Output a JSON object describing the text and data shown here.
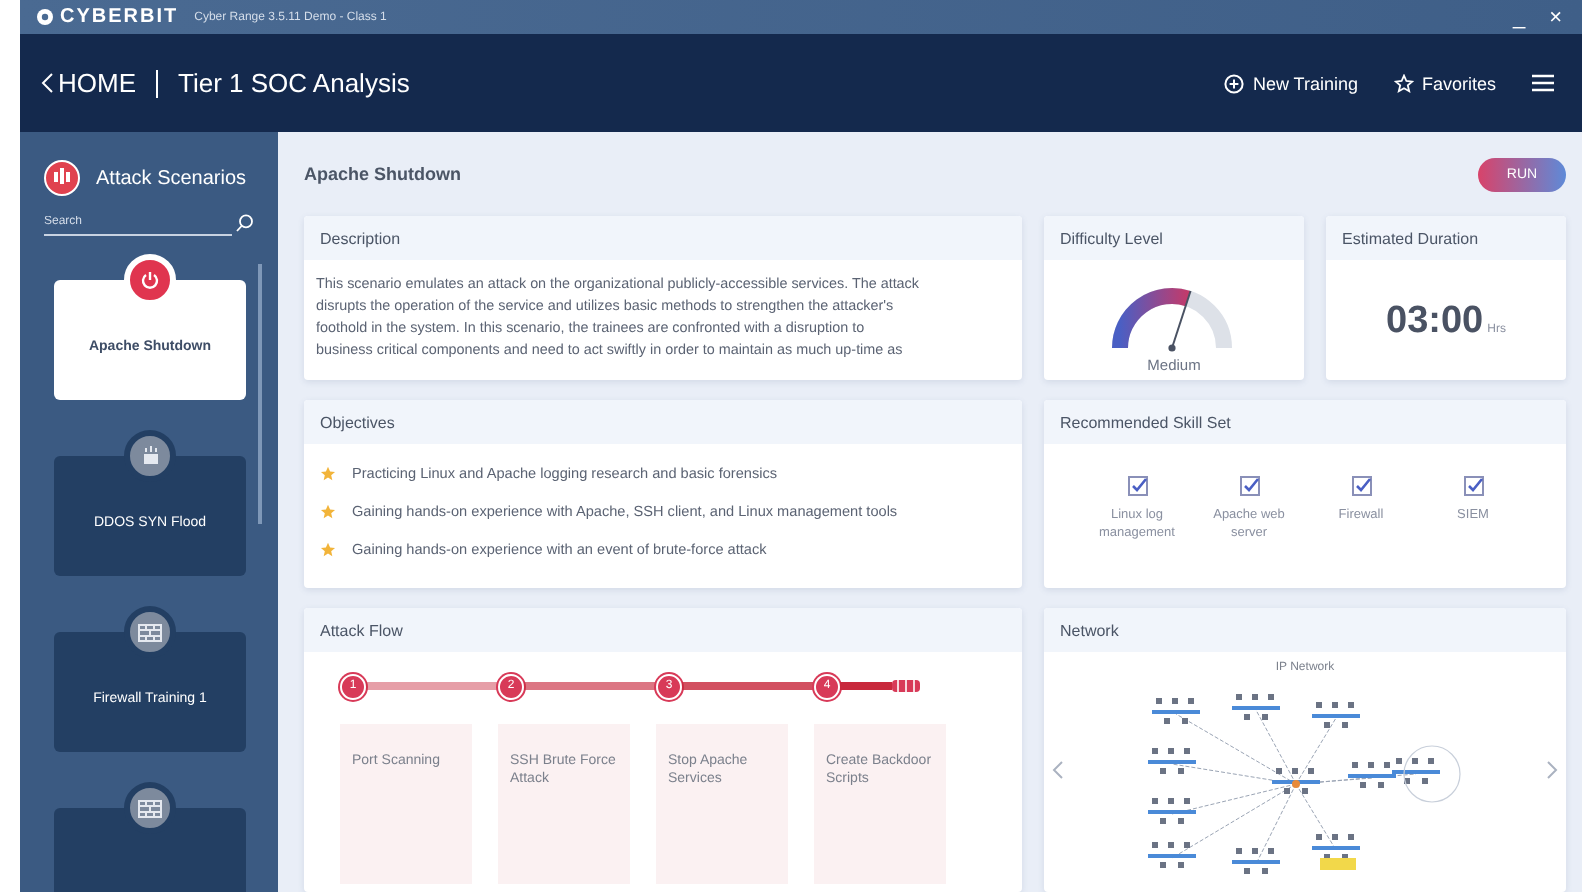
{
  "window": {
    "brand": "CYBERBIT",
    "title": "Cyber Range 3.5.11 Demo - Class 1",
    "controls": [
      "_",
      "×"
    ]
  },
  "nav": {
    "back": "HOME",
    "title": "Tier 1 SOC Analysis",
    "actions": [
      {
        "kind": "new",
        "label": "New Training"
      },
      {
        "kind": "favorites",
        "label": "Favorites"
      }
    ]
  },
  "sidebar": {
    "title": "Attack Scenarios",
    "search": {
      "placeholder": "Search"
    },
    "items": [
      {
        "kind": "power",
        "label": "Apache Shutdown",
        "selected": true
      },
      {
        "kind": "ddos",
        "label": "DDOS SYN Flood",
        "selected": false
      },
      {
        "kind": "firewall",
        "label": "Firewall Training 1",
        "selected": false
      },
      {
        "kind": "firewall",
        "selected": false
      }
    ]
  },
  "scenario": {
    "title": "Apache Shutdown",
    "run": "RUN"
  },
  "description": {
    "title": "Description",
    "lines": [
      "This scenario emulates an attack on the organizational publicly-accessible services. The attack",
      "disrupts the operation of the service and utilizes basic methods to strengthen the attacker's",
      "foothold in the system. In this scenario, the trainees are confronted with a disruption to",
      "business critical components and need to act swiftly in order to maintain as much up-time as"
    ]
  },
  "difficulty": {
    "title": "Difficulty Level",
    "level": 0.6,
    "label": "Medium"
  },
  "duration": {
    "title": "Estimated Duration",
    "value": "03:00",
    "unit": "Hrs"
  },
  "objectives": {
    "title": "Objectives",
    "items": [
      "Practicing Linux and Apache logging research and basic forensics",
      "Gaining hands-on experience with Apache, SSH client, and Linux management tools",
      "Gaining hands-on experience with an event of brute-force attack"
    ]
  },
  "skills": {
    "title": "Recommended Skill Set",
    "items": [
      {
        "label": "Linux log management",
        "checked": true
      },
      {
        "label": "Apache web server",
        "checked": true
      },
      {
        "label": "Firewall",
        "checked": true
      },
      {
        "label": "SIEM",
        "checked": true
      }
    ]
  },
  "attack_flow": {
    "title": "Attack Flow",
    "steps": [
      {
        "number": "1",
        "label": "Port Scanning"
      },
      {
        "number": "2",
        "label": "SSH Brute Force Attack"
      },
      {
        "number": "3",
        "label": "Stop Apache Services"
      },
      {
        "number": "4",
        "label": "Create Backdoor Scripts"
      }
    ]
  },
  "network": {
    "title": "Network",
    "diagram_title": "IP Network"
  }
}
